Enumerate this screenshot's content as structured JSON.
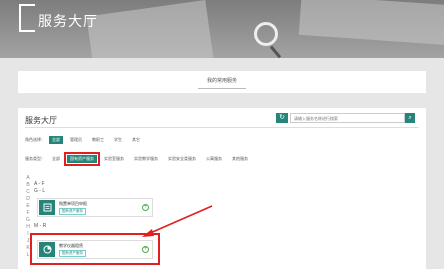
{
  "hero": {
    "title": "服务大厅"
  },
  "common_services": {
    "title": "我的常用服务"
  },
  "panel": {
    "heading": "服务大厅",
    "search_placeholder": "请输入服务名称进行搜索",
    "role_filter": {
      "label": "角色选择：",
      "options": [
        "全部",
        "管理员",
        "教职工",
        "学生",
        "其它"
      ]
    },
    "type_filter": {
      "label": "服务类型：",
      "options": [
        "全部",
        "国有资产服务",
        "实验室服务",
        "实验教学服务",
        "实验安全类服务",
        "公寓服务",
        "其他服务"
      ]
    },
    "alphabet": [
      "A",
      "B",
      "C",
      "D",
      "E",
      "F",
      "G",
      "H",
      "I",
      "J",
      "K",
      "L"
    ],
    "groups": [
      "A - F",
      "G - L",
      "M - R"
    ],
    "cards": [
      {
        "name": "购置单项目申报",
        "tag": "国有资产服务"
      },
      {
        "name": "教学仪器租赁",
        "tag": "国有资产服务"
      }
    ]
  },
  "colors": {
    "accent": "#26857a",
    "annotation": "#e02020"
  },
  "icons": [
    "refresh-icon",
    "search-icon",
    "document-icon",
    "pie-chart-icon",
    "plus-circle-icon",
    "magnifier-icon"
  ]
}
